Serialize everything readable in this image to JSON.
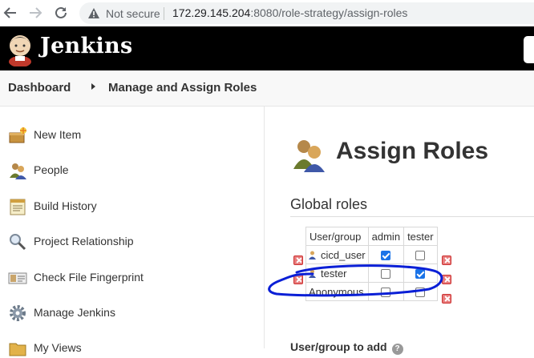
{
  "browser": {
    "back_icon": "arrow-left-icon",
    "forward_icon": "arrow-right-icon",
    "reload_icon": "reload-icon",
    "security_label": "Not secure",
    "url_host": "172.29.145.204",
    "url_rest": ":8080/role-strategy/assign-roles"
  },
  "header": {
    "app_name": "Jenkins"
  },
  "breadcrumb": {
    "items": [
      "Dashboard",
      "Manage and Assign Roles"
    ]
  },
  "sidebar": {
    "items": [
      {
        "label": "New Item",
        "icon": "new-item-icon"
      },
      {
        "label": "People",
        "icon": "people-icon"
      },
      {
        "label": "Build History",
        "icon": "notepad-icon"
      },
      {
        "label": "Project Relationship",
        "icon": "magnifier-icon"
      },
      {
        "label": "Check File Fingerprint",
        "icon": "fingerprint-icon"
      },
      {
        "label": "Manage Jenkins",
        "icon": "gear-icon"
      },
      {
        "label": "My Views",
        "icon": "folder-icon"
      }
    ]
  },
  "main": {
    "title": "Assign Roles",
    "global_roles": {
      "section_title": "Global roles",
      "columns": [
        "User/group",
        "admin",
        "tester"
      ],
      "rows": [
        {
          "name": "cicd_user",
          "admin": true,
          "tester": false
        },
        {
          "name": "tester",
          "admin": false,
          "tester": true
        },
        {
          "name": "Anonymous",
          "admin": false,
          "tester": false
        }
      ]
    },
    "add_user_label": "User/group to add",
    "help_label": "?"
  },
  "colors": {
    "header_bg": "#000000",
    "annotation": "#0a1fd6",
    "checkbox_on": "#1a73e8"
  }
}
